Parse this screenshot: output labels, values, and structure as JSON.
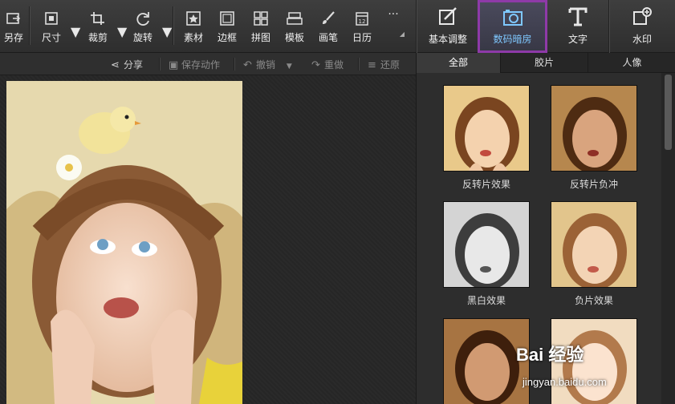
{
  "toolbar": {
    "tools": [
      {
        "label": "另存",
        "icon": "save-as-icon"
      },
      {
        "label": "尺寸",
        "icon": "resize-icon"
      },
      {
        "label": "裁剪",
        "icon": "crop-icon"
      },
      {
        "label": "旋转",
        "icon": "rotate-icon"
      },
      {
        "label": "素材",
        "icon": "sticker-icon"
      },
      {
        "label": "边框",
        "icon": "frame-icon"
      },
      {
        "label": "拼图",
        "icon": "collage-icon"
      },
      {
        "label": "模板",
        "icon": "template-icon"
      },
      {
        "label": "画笔",
        "icon": "brush-icon"
      },
      {
        "label": "日历",
        "icon": "calendar-icon"
      }
    ],
    "more": "···",
    "modes": [
      {
        "label": "基本调整",
        "icon": "basic-adjust-icon"
      },
      {
        "label": "数码暗房",
        "icon": "darkroom-icon"
      },
      {
        "label": "文字",
        "icon": "text-icon"
      },
      {
        "label": "水印",
        "icon": "watermark-icon"
      }
    ]
  },
  "subbar": {
    "share": "分享",
    "save_action": "保存动作",
    "undo": "撤销",
    "redo": "重做",
    "restore": "还原"
  },
  "panel": {
    "tabs": [
      "全部",
      "胶片",
      "人像"
    ],
    "effects": [
      {
        "label": "反转片效果"
      },
      {
        "label": "反转片负冲"
      },
      {
        "label": "黑白效果"
      },
      {
        "label": "负片效果"
      }
    ]
  },
  "watermark": {
    "brand": "Bai  经验",
    "url": "jingyan.baidu.com"
  },
  "colors": {
    "active_border": "#8e3aa8",
    "active_text": "#7fc8ff"
  }
}
